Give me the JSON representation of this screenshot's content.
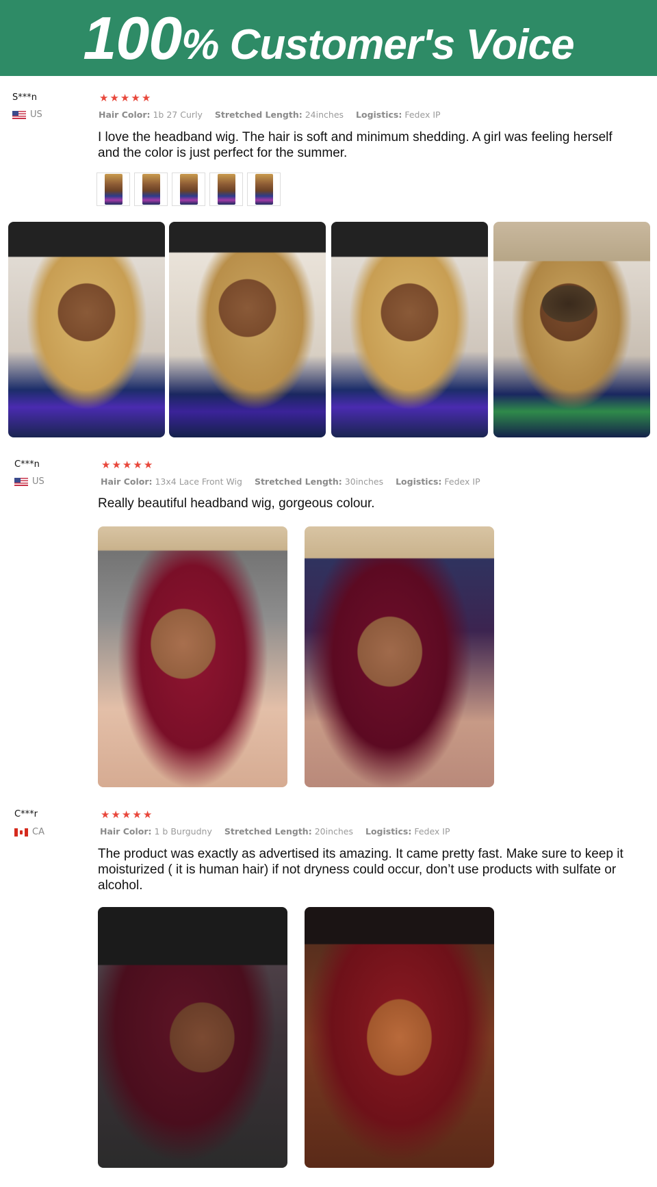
{
  "banner": {
    "title_big": "100",
    "title_rest": "% Customer's Voice",
    "background": "#2e8b66"
  },
  "labels": {
    "hair_color": "Hair Color:",
    "stretched_length": "Stretched Length:",
    "logistics": "Logistics:"
  },
  "reviews": [
    {
      "name": "S***n",
      "country": "US",
      "rating": 5,
      "hair_color": "1b 27 Curly",
      "stretched_length": "24inches",
      "logistics": "Fedex IP",
      "text": "I love the headband wig. The hair is soft and minimum shedding. A girl was feeling herself and the color is just perfect for the summer.",
      "thumbnail_count": 5,
      "photo_count": 4
    },
    {
      "name": "C***n",
      "country": "US",
      "rating": 5,
      "hair_color": "13x4 Lace Front Wig",
      "stretched_length": "30inches",
      "logistics": "Fedex IP",
      "text": "Really beautiful headband wig, gorgeous colour.",
      "photo_count": 2
    },
    {
      "name": "C***r",
      "country": "CA",
      "rating": 5,
      "hair_color": "1 b Burgudny",
      "stretched_length": "20inches",
      "logistics": "Fedex IP",
      "text": "The product was exactly as advertised its amazing. It came pretty fast. Make sure to keep it moisturized ( it is human hair) if not dryness could occur, don’t use products with sulfate or alcohol.",
      "photo_count": 2
    }
  ],
  "colors": {
    "star": "#e8473b",
    "attr_text": "#999999"
  }
}
